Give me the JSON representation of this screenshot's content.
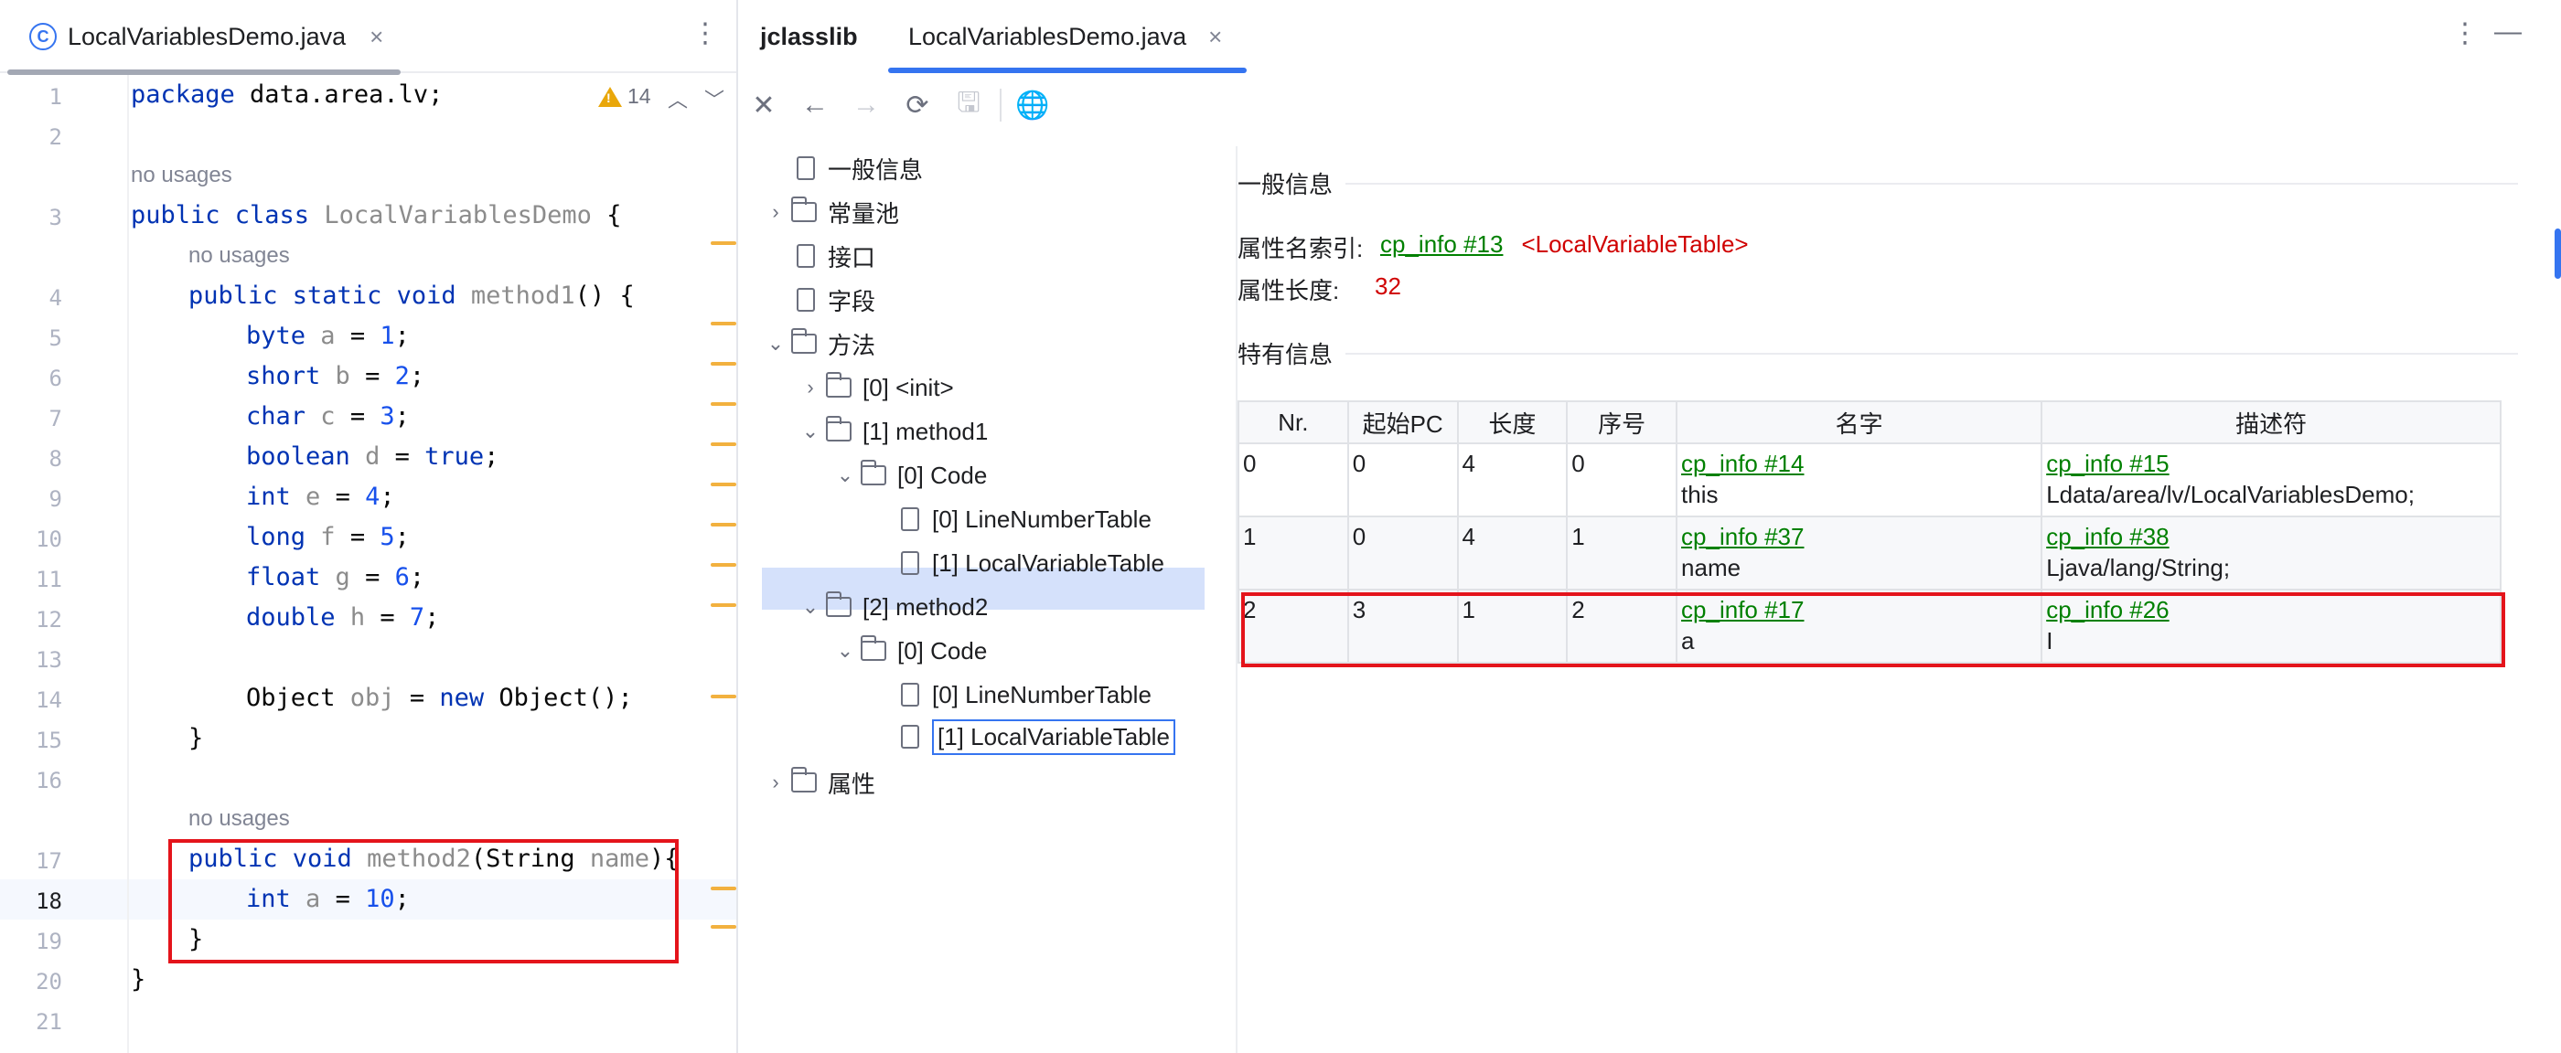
{
  "editor": {
    "tab_title": "LocalVariablesDemo.java",
    "warning_count": "14",
    "line_numbers": [
      "1",
      "2",
      "3",
      "4",
      "5",
      "6",
      "7",
      "8",
      "9",
      "10",
      "11",
      "12",
      "13",
      "14",
      "15",
      "16",
      "17",
      "18",
      "19",
      "20",
      "21"
    ],
    "usage_hint": "no usages"
  },
  "jclasslib": {
    "tabs": [
      "jclasslib",
      "LocalVariablesDemo.java"
    ],
    "tree": {
      "general": "一般信息",
      "constant_pool": "常量池",
      "interfaces": "接口",
      "fields": "字段",
      "methods": "方法",
      "init": "[0] <init>",
      "method1": "[1] method1",
      "m1_code": "[0] Code",
      "m1_lnt": "[0] LineNumberTable",
      "m1_lvt": "[1] LocalVariableTable",
      "method2": "[2] method2",
      "m2_code": "[0] Code",
      "m2_lnt": "[0] LineNumberTable",
      "m2_lvt": "[1] LocalVariableTable",
      "attributes": "属性"
    },
    "detail": {
      "general_title": "一般信息",
      "attr_name_index_label": "属性名索引:",
      "attr_name_index_link": "cp_info #13",
      "attr_name_index_value": "<LocalVariableTable>",
      "attr_length_label": "属性长度:",
      "attr_length_value": "32",
      "specific_title": "特有信息",
      "columns": [
        "Nr.",
        "起始PC",
        "长度",
        "序号",
        "名字",
        "描述符"
      ],
      "rows": [
        {
          "nr": "0",
          "start_pc": "0",
          "length": "4",
          "index": "0",
          "name_link": "cp_info #14",
          "name": "this",
          "desc_link": "cp_info #15",
          "desc": "Ldata/area/lv/LocalVariablesDemo;"
        },
        {
          "nr": "1",
          "start_pc": "0",
          "length": "4",
          "index": "1",
          "name_link": "cp_info #37",
          "name": "name",
          "desc_link": "cp_info #38",
          "desc": "Ljava/lang/String;"
        },
        {
          "nr": "2",
          "start_pc": "3",
          "length": "1",
          "index": "2",
          "name_link": "cp_info #17",
          "name": "a",
          "desc_link": "cp_info #26",
          "desc": "I"
        }
      ]
    }
  },
  "colors": {
    "keyword": "#0033b3",
    "number": "#1750eb",
    "link": "#008000",
    "highlight_box": "#e4141b",
    "accent": "#3574f0"
  }
}
